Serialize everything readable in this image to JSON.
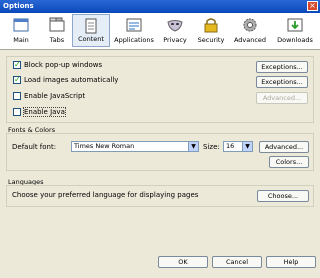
{
  "window": {
    "title": "Options",
    "close_label": "×"
  },
  "tabs": [
    {
      "label": "Main",
      "icon": "window-icon"
    },
    {
      "label": "Tabs",
      "icon": "tabs-icon"
    },
    {
      "label": "Content",
      "icon": "document-icon",
      "selected": true
    },
    {
      "label": "Applications",
      "icon": "applications-icon"
    },
    {
      "label": "Privacy",
      "icon": "mask-icon"
    },
    {
      "label": "Security",
      "icon": "lock-icon"
    },
    {
      "label": "Advanced",
      "icon": "gear-icon"
    },
    {
      "label": "Downloads",
      "icon": "download-icon"
    }
  ],
  "content": {
    "block_popups": {
      "label": "Block pop-up windows",
      "checked": true
    },
    "load_images": {
      "label": "Load images automatically",
      "checked": true
    },
    "enable_js": {
      "label": "Enable JavaScript",
      "checked": false
    },
    "enable_java": {
      "label": "Enable Java",
      "checked": false
    },
    "exceptions_label": "Exceptions...",
    "advanced_label": "Advanced..."
  },
  "fonts": {
    "legend": "Fonts & Colors",
    "default_font_label": "Default font:",
    "default_font_value": "Times New Roman",
    "size_label": "Size:",
    "size_value": "16",
    "advanced_label": "Advanced...",
    "colors_label": "Colors..."
  },
  "languages": {
    "legend": "Languages",
    "description": "Choose your preferred language for displaying pages",
    "choose_label": "Choose..."
  },
  "footer": {
    "ok_label": "OK",
    "cancel_label": "Cancel",
    "help_label": "Help"
  }
}
